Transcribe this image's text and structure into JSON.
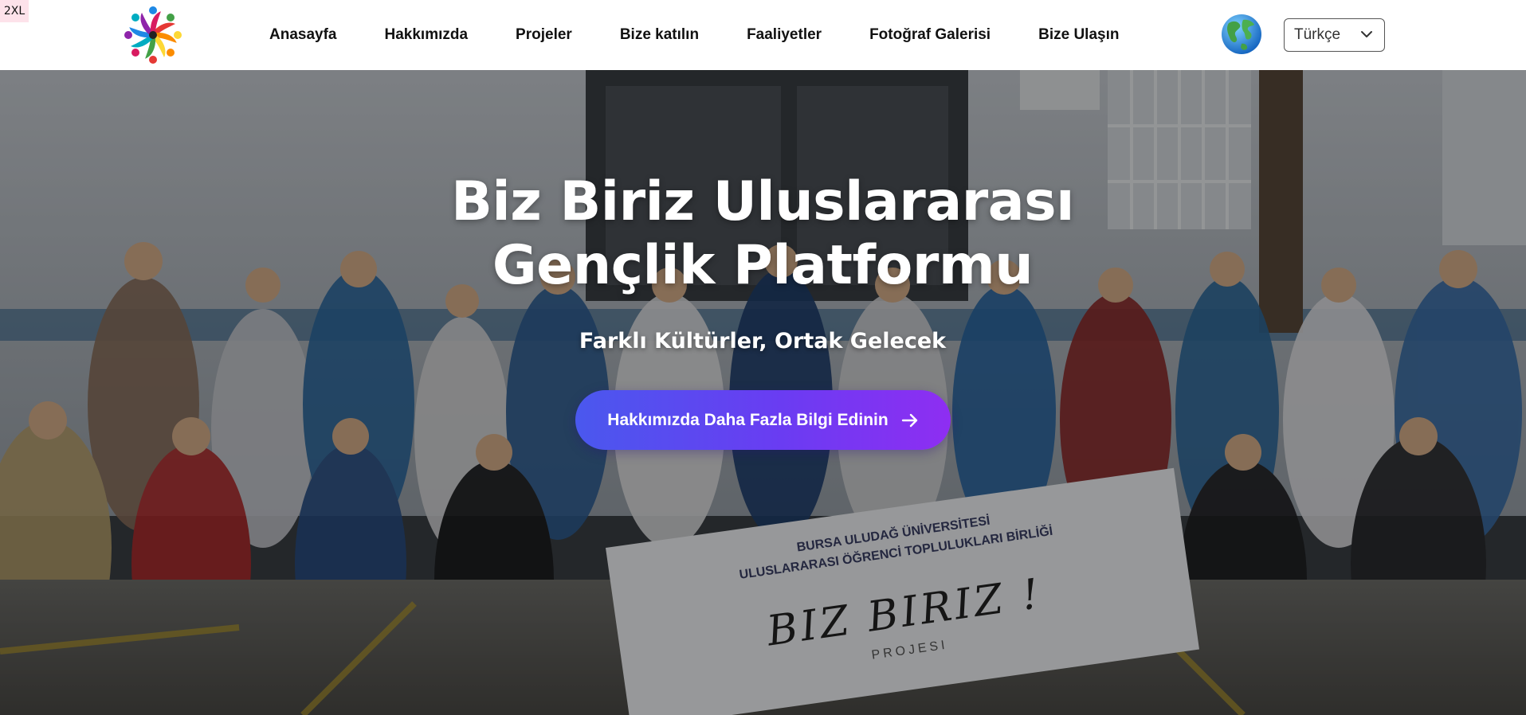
{
  "viewport_badge": "2XL",
  "nav": {
    "items": [
      {
        "label": "Anasayfa"
      },
      {
        "label": "Hakkımızda"
      },
      {
        "label": "Projeler"
      },
      {
        "label": "Bize katılın"
      },
      {
        "label": "Faaliyetler"
      },
      {
        "label": "Fotoğraf Galerisi"
      },
      {
        "label": "Bize Ulaşın"
      }
    ],
    "globe_icon": "globe-icon",
    "language": {
      "selected": "Türkçe",
      "icon": "chevron-down-icon"
    }
  },
  "hero": {
    "title_line1": "Biz Biriz Uluslararası",
    "title_line2": "Gençlik Platformu",
    "subtitle": "Farklı Kültürler, Ortak Gelecek",
    "cta_label": "Hakkımızda Daha Fazla Bilgi Edinin",
    "cta_icon": "arrow-right-icon",
    "banner_text": {
      "line1": "BURSA ULUDAĞ ÜNİVERSİTESİ",
      "line2": "ULUSLARARASI ÖĞRENCİ TOPLULUKLARI BİRLİĞİ",
      "line3": "BIZ BIRIZ !",
      "line4": "PROJESI"
    }
  },
  "colors": {
    "cta_gradient_start": "#4a58ee",
    "cta_gradient_end": "#8e2ef2",
    "nav_text": "#111111",
    "hero_text": "#ffffff"
  }
}
